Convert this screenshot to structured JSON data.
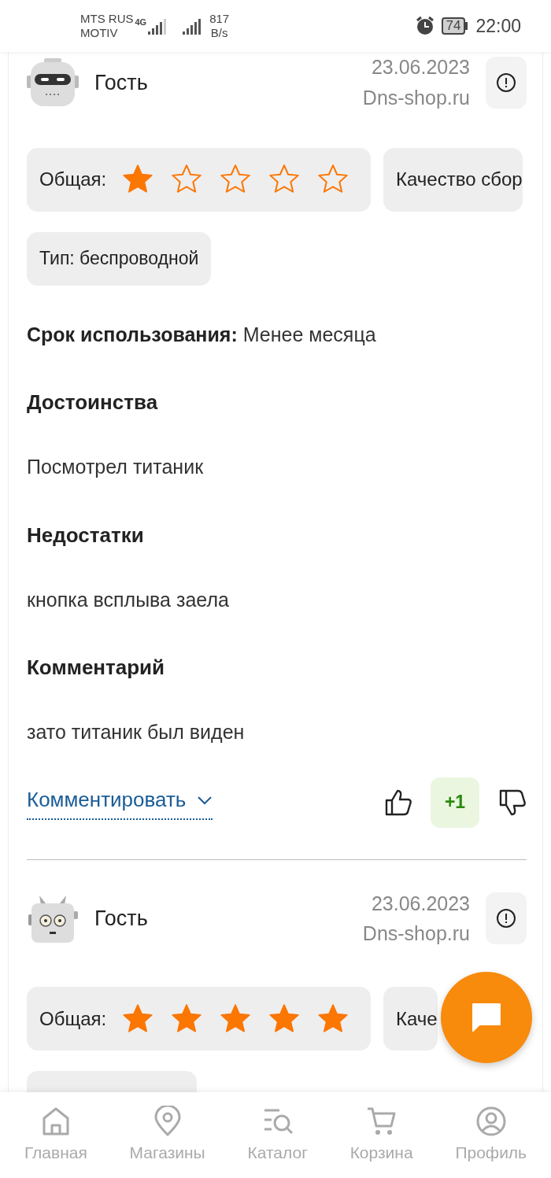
{
  "status_bar": {
    "carrier_1": "MTS RUS",
    "carrier_2": "MOTIV",
    "network": "4G",
    "speed_value": "817",
    "speed_unit": "B/s",
    "battery": "74",
    "time": "22:00"
  },
  "reviews": [
    {
      "author": "Гость",
      "date": "23.06.2023",
      "source": "Dns-shop.ru",
      "ratings": [
        {
          "label": "Общая:",
          "stars": 1
        },
        {
          "label": "Качество сбор"
        }
      ],
      "chips": [
        "Тип: беспроводной"
      ],
      "usage": {
        "label": "Срок использования:",
        "value": "Менее месяца"
      },
      "sections": [
        {
          "heading": "Достоинства",
          "text": "Посмотрел титаник"
        },
        {
          "heading": "Недостатки",
          "text": "кнопка всплыва заела"
        },
        {
          "heading": "Комментарий",
          "text": "зато титаник был виден"
        }
      ],
      "comment_link": "Комментировать",
      "votes": "+1"
    },
    {
      "author": "Гость",
      "date": "23.06.2023",
      "source": "Dns-shop.ru",
      "ratings": [
        {
          "label": "Общая:",
          "stars": 5
        },
        {
          "label": "Каче"
        }
      ],
      "cut_chip": true
    }
  ],
  "bottom_nav": [
    {
      "label": "Главная",
      "selected": false
    },
    {
      "label": "Магазины",
      "selected": false
    },
    {
      "label": "Каталог",
      "selected": false
    },
    {
      "label": "Корзина",
      "selected": false
    },
    {
      "label": "Профиль",
      "selected": false
    }
  ]
}
